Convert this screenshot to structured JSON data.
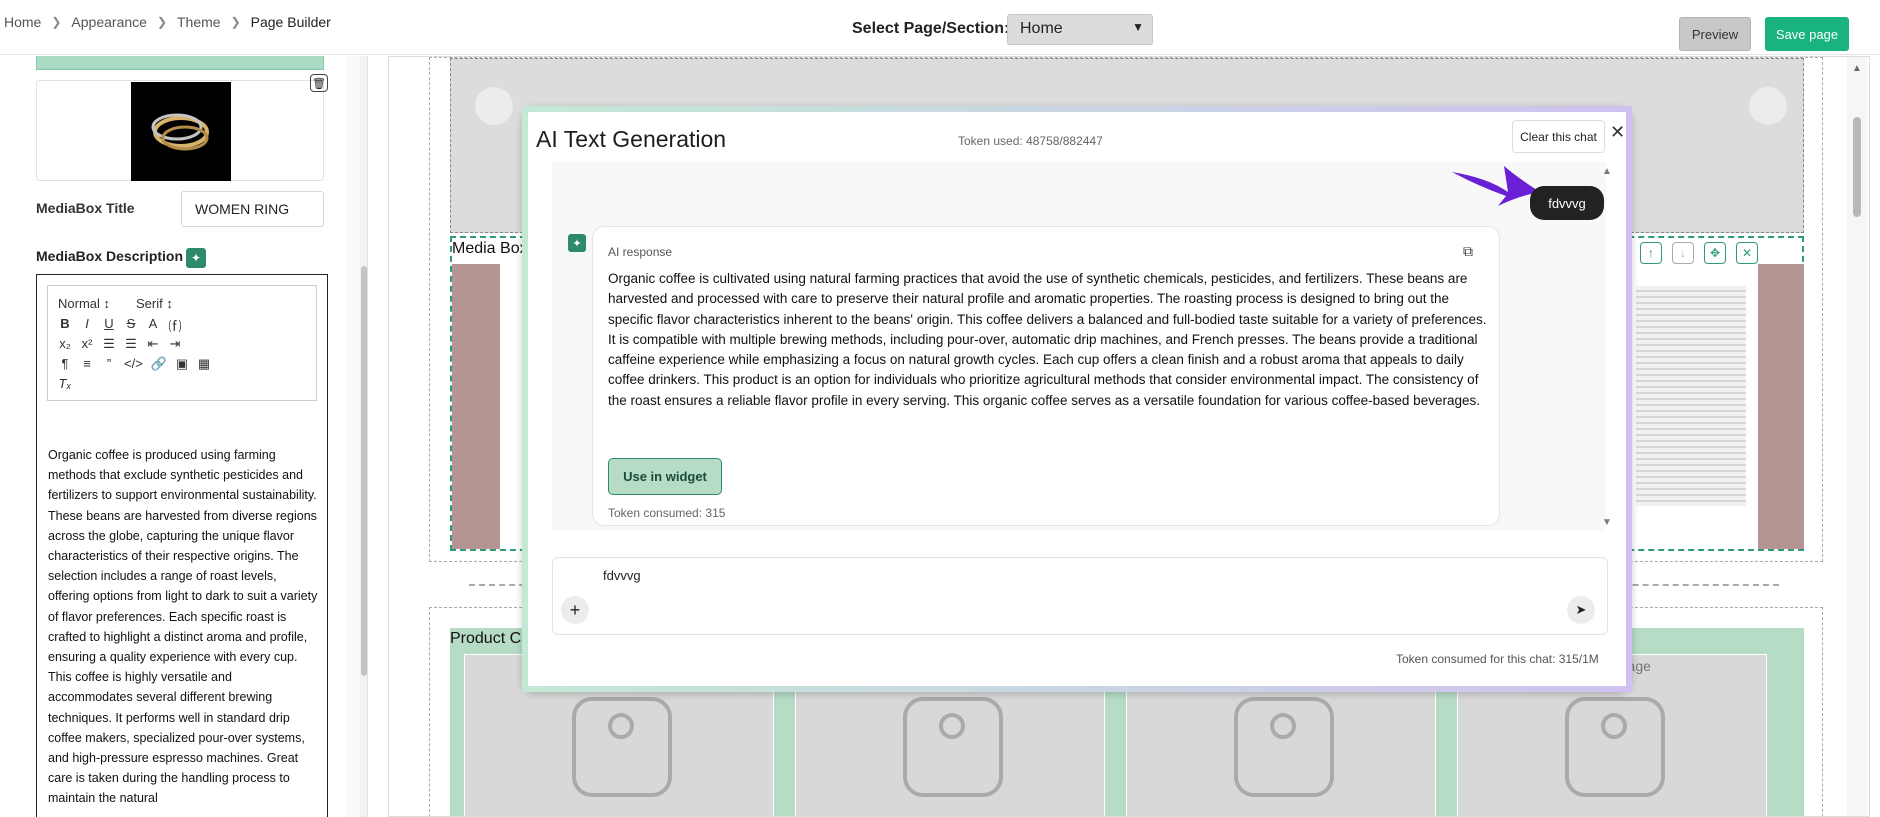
{
  "breadcrumb": [
    "Home",
    "Appearance",
    "Theme",
    "Page Builder"
  ],
  "header": {
    "select_label": "Select Page/Section:",
    "select_value": "Home",
    "preview_label": "Preview",
    "save_label": "Save page"
  },
  "left_panel": {
    "mediabox_title_label": "MediaBox Title",
    "mediabox_title_value": "WOMEN RING",
    "mediabox_desc_label": "MediaBox Description",
    "editor": {
      "format_select": "Normal",
      "font_select": "Serif",
      "text": "Organic coffee is produced using farming methods that exclude synthetic pesticides and fertilizers to support environmental sustainability. These beans are harvested from diverse regions across the globe, capturing the unique flavor characteristics of their respective origins. The selection includes a range of roast levels, offering options from light to dark to suit a variety of flavor preferences. Each specific roast is crafted to highlight a distinct aroma and profile, ensuring a quality experience with every cup. This coffee is highly versatile and accommodates several different brewing techniques. It performs well in standard drip coffee makers, specialized pour-over systems, and high-pressure espresso machines. Great care is taken during the handling process to maintain the natural"
    }
  },
  "canvas": {
    "mediabox_label": "Media Box",
    "product_label": "Product C",
    "image_text": "Image"
  },
  "modal": {
    "title": "AI Text Generation",
    "token_used": "Token used: 48758/882447",
    "clear_label": "Clear this chat",
    "user_message": "fdvvvg",
    "ai_response_label": "AI response",
    "ai_response_text": "Organic coffee is cultivated using natural farming practices that avoid the use of synthetic chemicals, pesticides, and fertilizers. These beans are harvested and processed with care to preserve their natural profile and aromatic properties. The roasting process is designed to bring out the specific flavor characteristics inherent to the beans' origin. This coffee delivers a balanced and full-bodied taste suitable for a variety of preferences. It is compatible with multiple brewing methods, including pour-over, automatic drip machines, and French presses. The beans provide a traditional caffeine experience while emphasizing a focus on natural growth cycles. Each cup offers a clean finish and a robust aroma that appeals to daily coffee drinkers. This product is an option for individuals who prioritize agricultural methods that consider environmental impact. The consistency of the roast ensures a reliable flavor profile in every serving. This organic coffee serves as a versatile foundation for various coffee-based beverages.",
    "use_label": "Use in widget",
    "token_consumed": "Token consumed: 315",
    "input_value": "fdvvvg",
    "chat_token": "Token consumed for this chat: 315/1M"
  },
  "colors": {
    "accent_green": "#18b381",
    "dark_green": "#2e8b69"
  }
}
